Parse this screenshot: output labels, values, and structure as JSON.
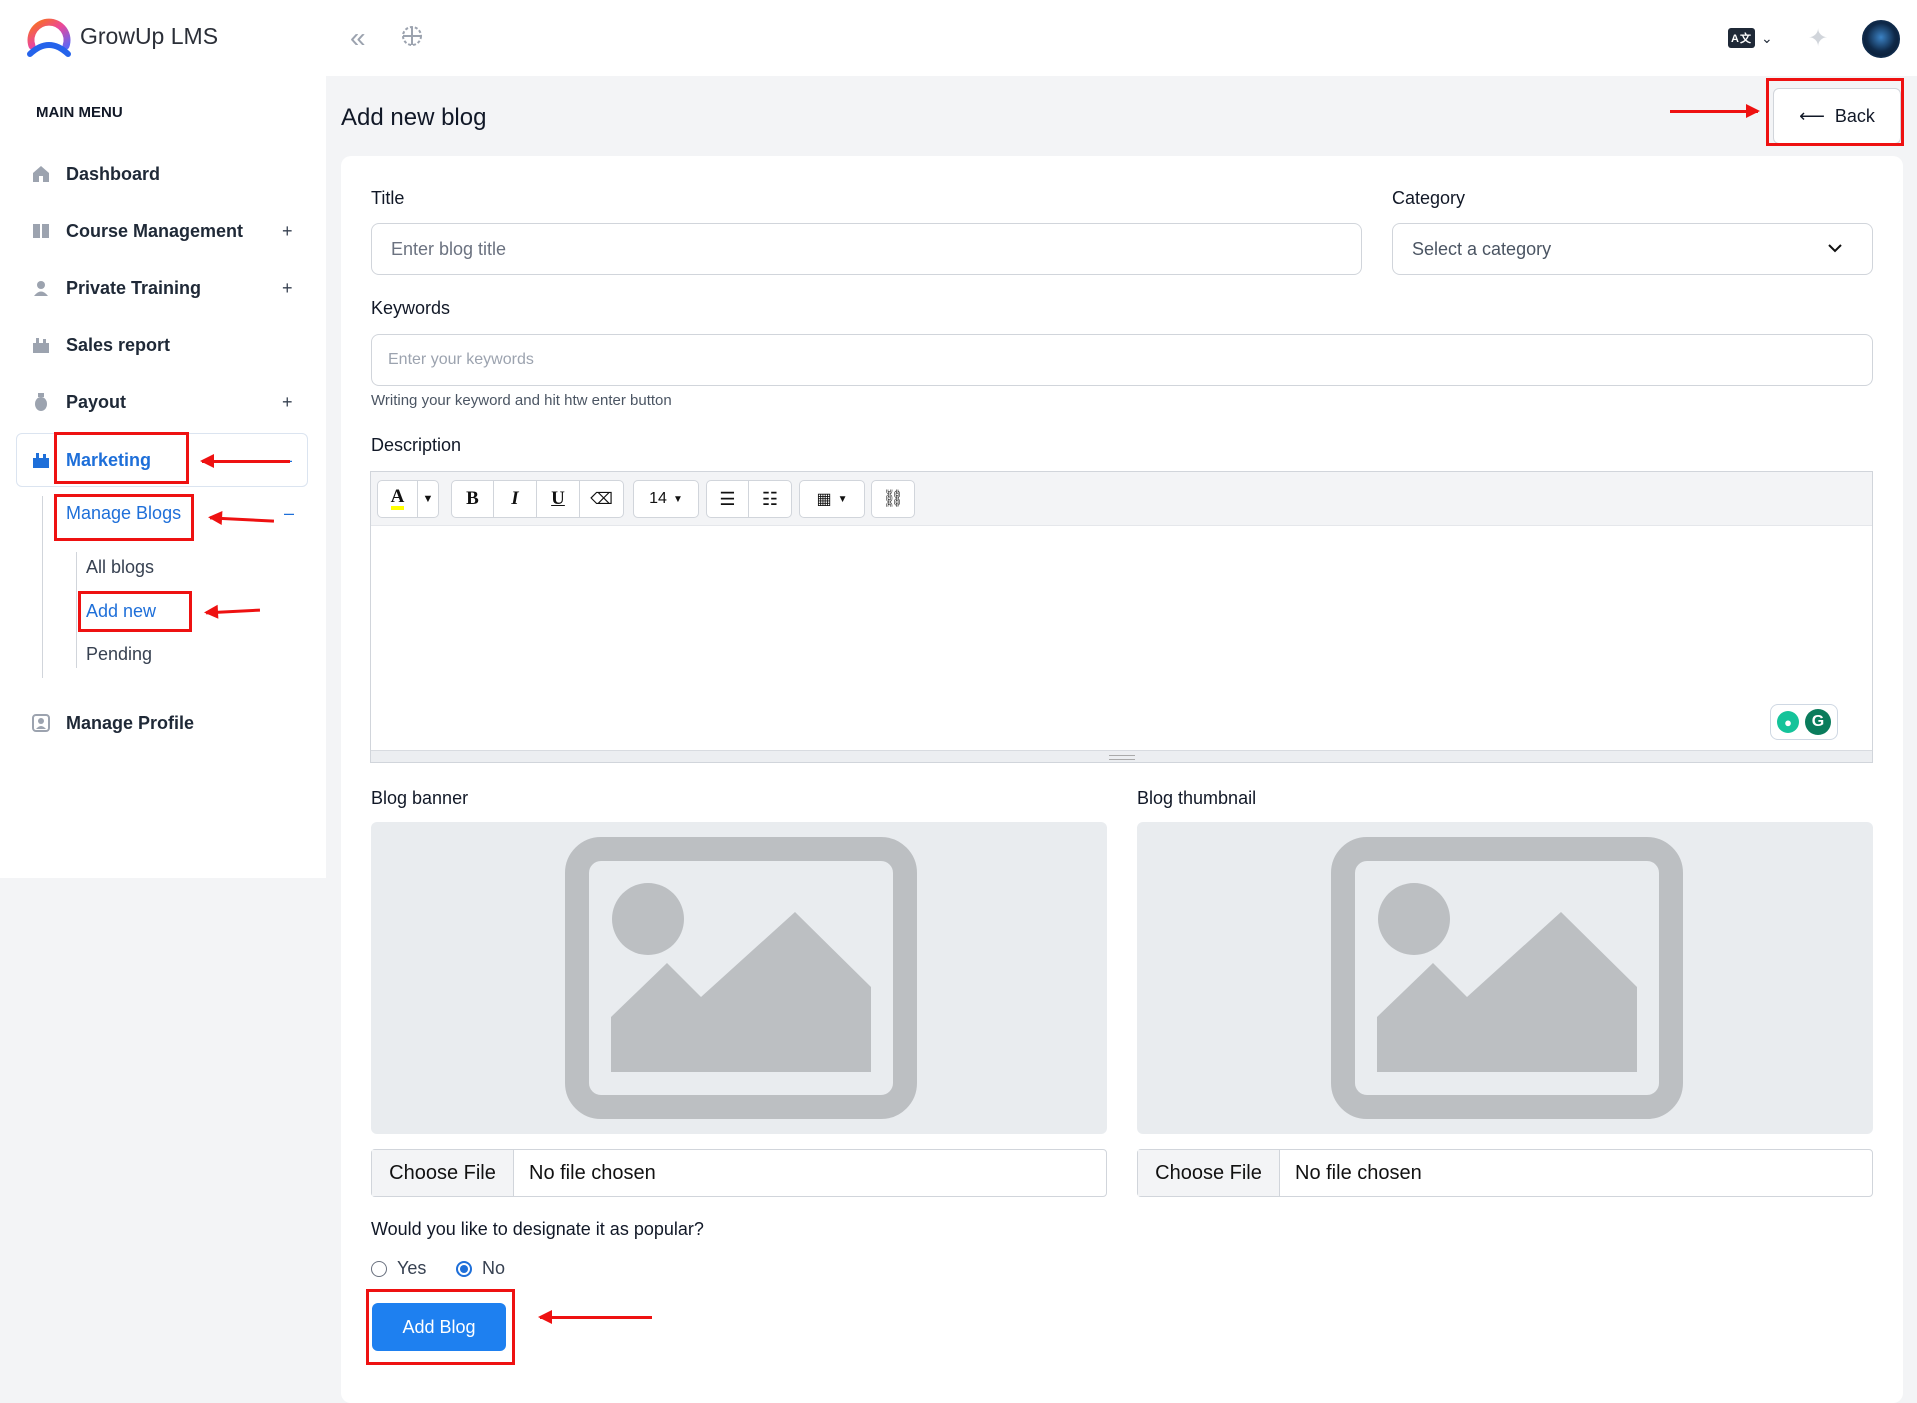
{
  "app": {
    "brand": "GrowUp LMS"
  },
  "topbar": {
    "language_badge": "A文",
    "icons": [
      "collapse-icon",
      "globe-icon",
      "language-icon",
      "chevron-down-icon",
      "sparkle-icon",
      "avatar"
    ]
  },
  "sidebar": {
    "menu_title": "MAIN MENU",
    "items": [
      {
        "label": "Dashboard",
        "icon": "home-icon",
        "expand": ""
      },
      {
        "label": "Course Management",
        "icon": "book-icon",
        "expand": "+"
      },
      {
        "label": "Private Training",
        "icon": "training-icon",
        "expand": "+"
      },
      {
        "label": "Sales report",
        "icon": "report-icon",
        "expand": ""
      },
      {
        "label": "Payout",
        "icon": "money-bag-icon",
        "expand": "+"
      },
      {
        "label": "Marketing",
        "icon": "marketing-icon",
        "expand": "–"
      },
      {
        "label": "Manage Profile",
        "icon": "profile-icon",
        "expand": ""
      }
    ],
    "submenu": {
      "label": "Manage Blogs",
      "expand": "–",
      "children": [
        "All blogs",
        "Add new",
        "Pending"
      ]
    },
    "active_color": "#1e6fd9"
  },
  "main": {
    "title": "Add new blog",
    "back_label": "Back",
    "form": {
      "title_label": "Title",
      "title_placeholder": "Enter blog title",
      "category_label": "Category",
      "category_value": "Select a category",
      "keywords_label": "Keywords",
      "keywords_placeholder": "Enter your keywords",
      "keywords_help": "Writing your keyword and hit htw enter button",
      "description_label": "Description",
      "editor": {
        "font_size": "14",
        "tools": [
          "text-color",
          "bold",
          "italic",
          "underline",
          "eraser",
          "font-size",
          "bullet-list",
          "numbered-list",
          "table",
          "link"
        ]
      },
      "banner_label": "Blog banner",
      "thumbnail_label": "Blog thumbnail",
      "choose_file": "Choose File",
      "no_file": "No file chosen",
      "popular_question": "Would you like to designate it as popular?",
      "popular_options": [
        "Yes",
        "No"
      ],
      "popular_selected": "No",
      "submit_label": "Add Blog"
    }
  },
  "annotations": {
    "highlight_color": "#ee1111"
  }
}
